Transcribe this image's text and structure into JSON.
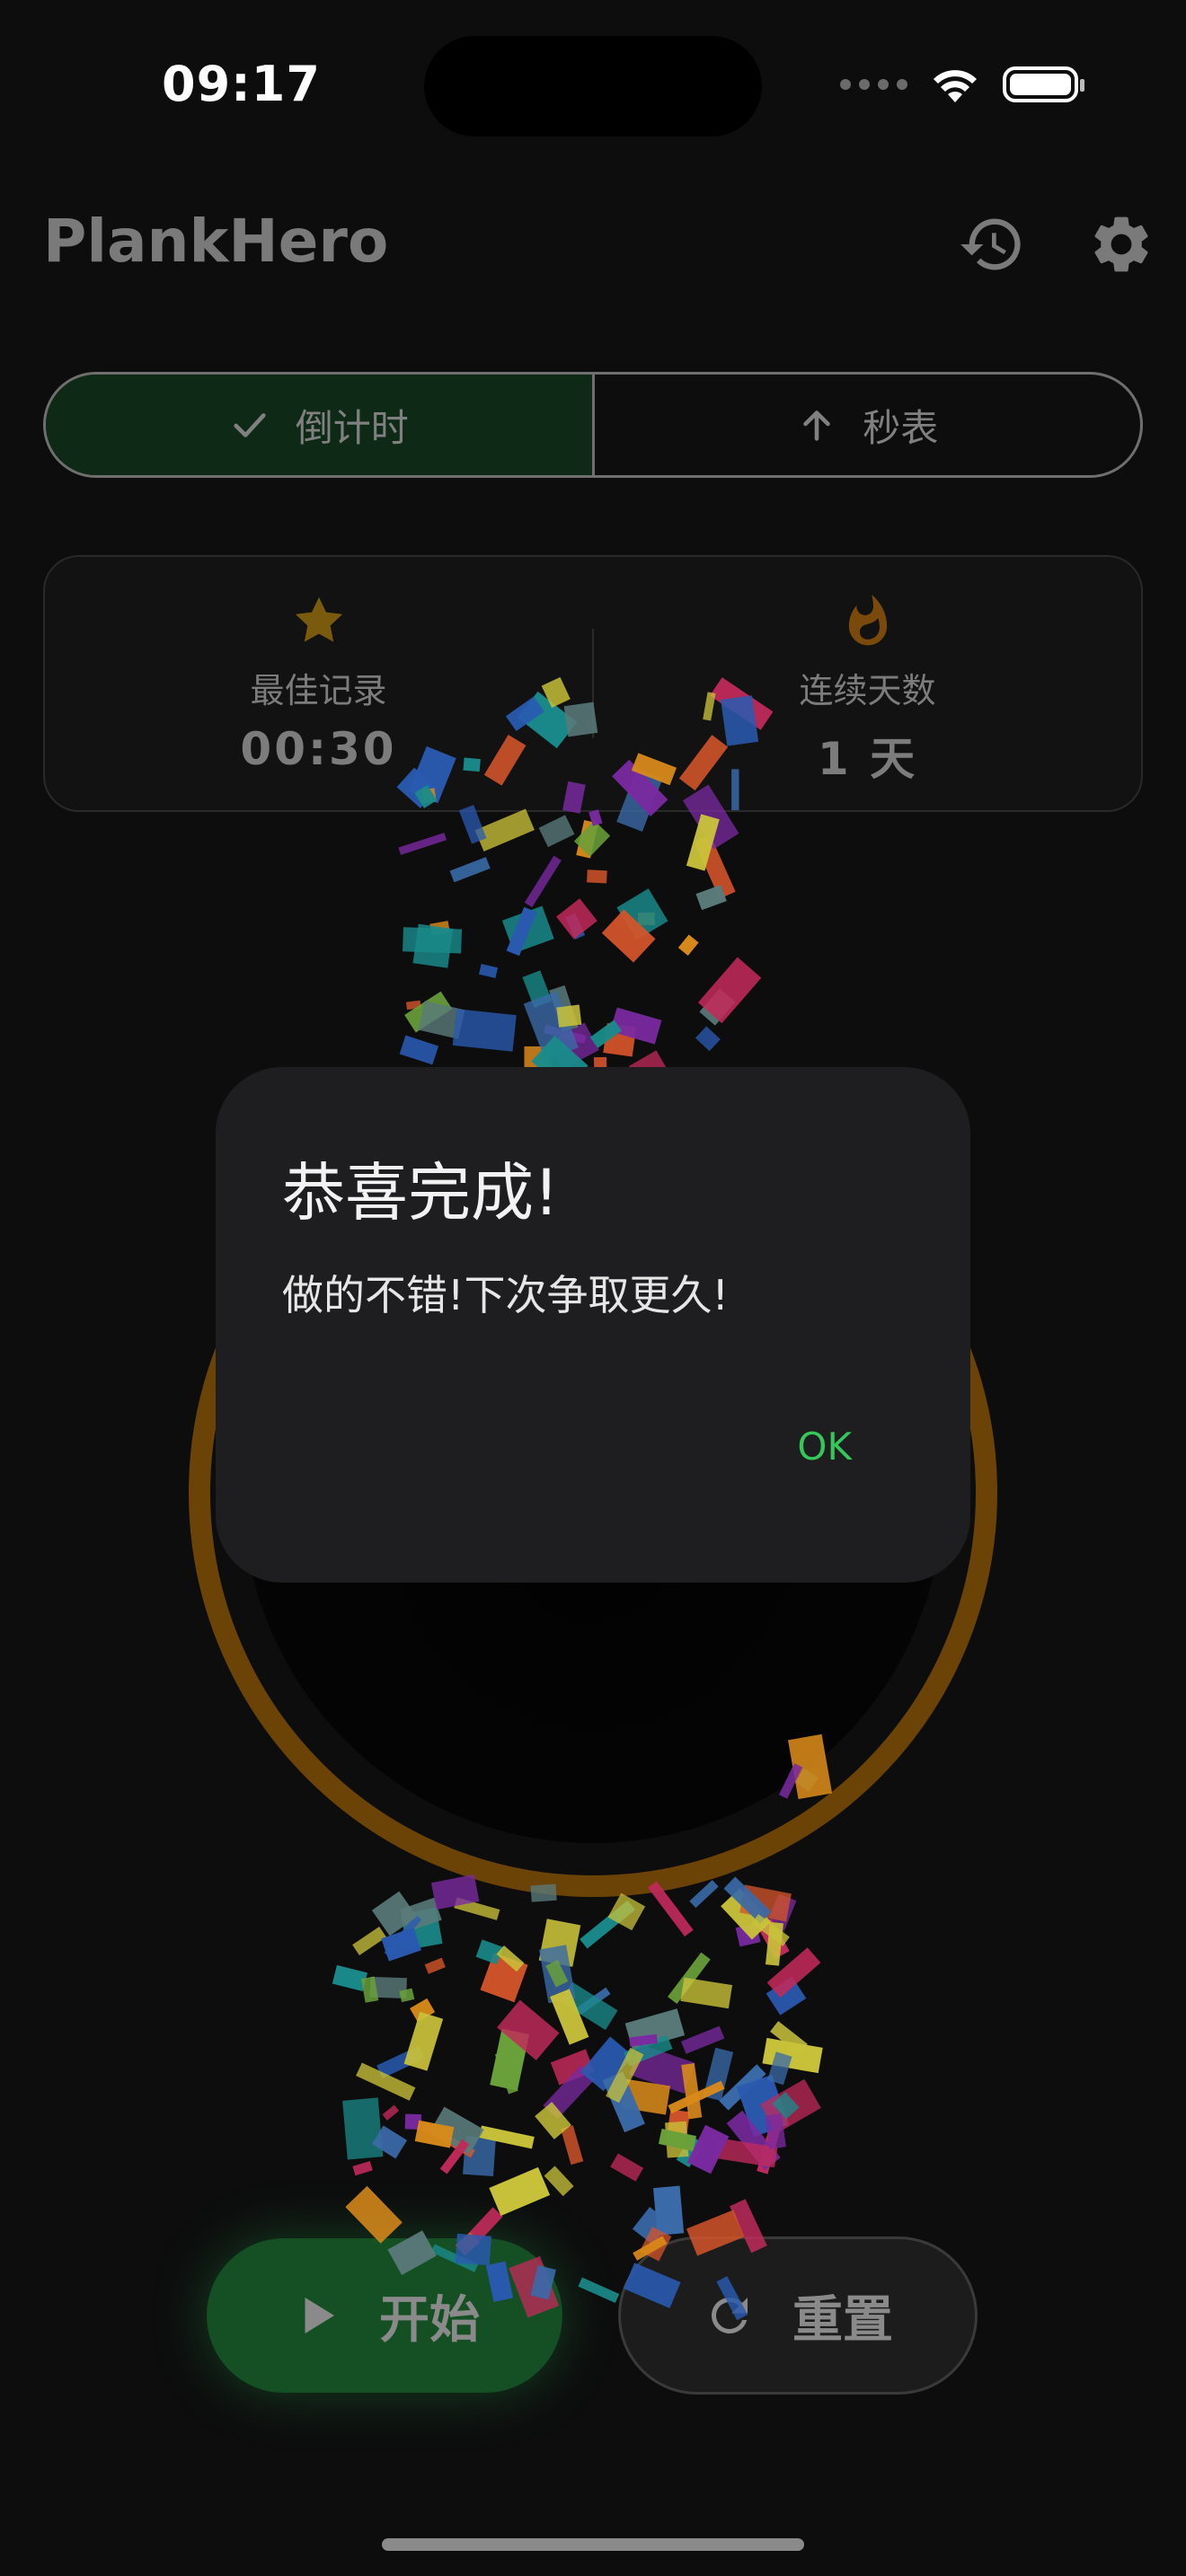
{
  "status_bar": {
    "time": "09:17"
  },
  "app_bar": {
    "title": "PlankHero",
    "icons": [
      "history-icon",
      "settings-gear-icon"
    ]
  },
  "mode_selector": {
    "options": [
      {
        "label": "倒计时",
        "icon": "checkmark-icon",
        "selected": true
      },
      {
        "label": "秒表",
        "icon": "arrow-up-icon",
        "selected": false
      }
    ]
  },
  "stats": {
    "best": {
      "label": "最佳记录",
      "value": "00:30",
      "icon": "star-icon"
    },
    "streak": {
      "label": "连续天数",
      "value": "1 天",
      "icon": "flame-icon"
    }
  },
  "dialog": {
    "title": "恭喜完成!",
    "message": "做的不错!下次争取更久!",
    "ok_label": "OK"
  },
  "controls": {
    "start_label": "开始",
    "reset_label": "重置"
  },
  "colors": {
    "accent_green": "#34c759",
    "ring_orange": "#6b4306",
    "star_gold": "#7a5a0c"
  }
}
